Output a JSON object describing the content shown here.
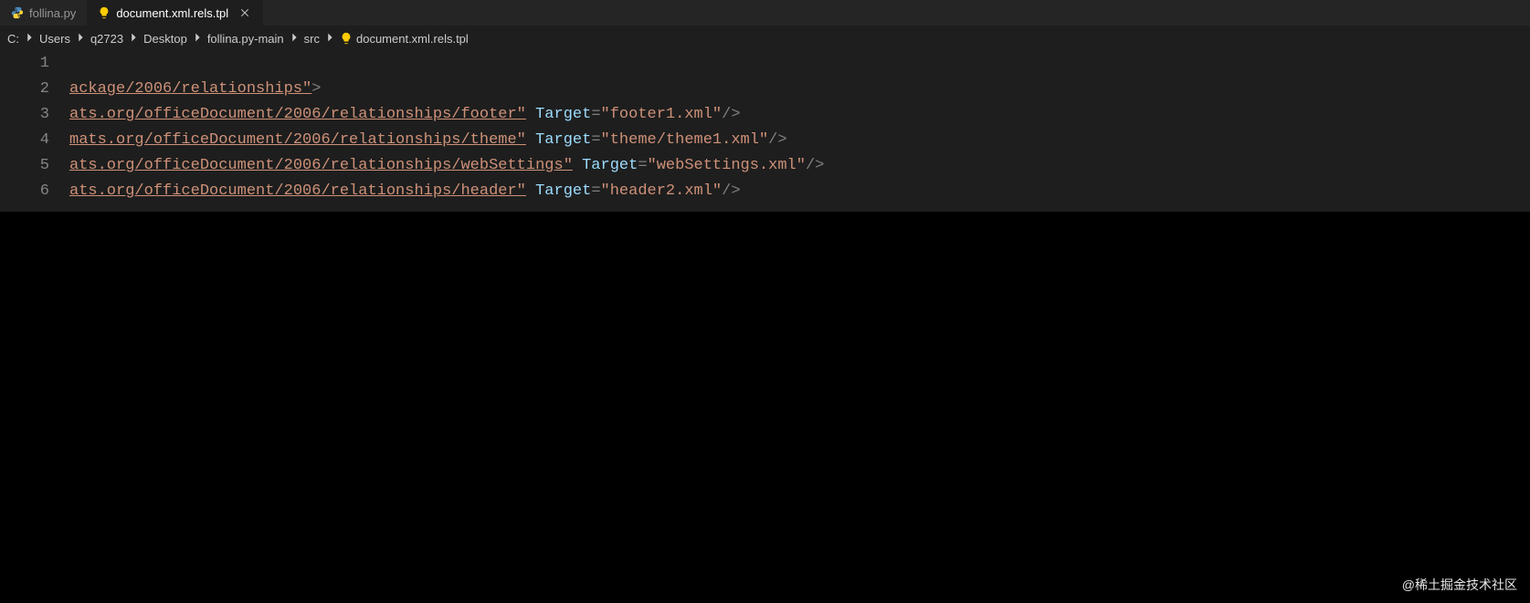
{
  "tabs": [
    {
      "label": "follina.py",
      "icon": "python",
      "active": false,
      "closable": false
    },
    {
      "label": "document.xml.rels.tpl",
      "icon": "bulb",
      "active": true,
      "closable": true
    }
  ],
  "breadcrumbs": {
    "items": [
      "C:",
      "Users",
      "q2723",
      "Desktop",
      "follina.py-main",
      "src"
    ],
    "file": {
      "icon": "bulb",
      "label": "document.xml.rels.tpl"
    }
  },
  "code": {
    "lines": [
      {
        "num": "1",
        "tokens": []
      },
      {
        "num": "2",
        "tokens": [
          {
            "t": "ackage/2006/relationships\"",
            "c": "tk-string-u"
          },
          {
            "t": ">",
            "c": "tk-punct"
          }
        ]
      },
      {
        "num": "3",
        "tokens": [
          {
            "t": "ats.org/officeDocument/2006/relationships/footer\"",
            "c": "tk-string-u"
          },
          {
            "t": " ",
            "c": ""
          },
          {
            "t": "Target",
            "c": "tk-attr"
          },
          {
            "t": "=",
            "c": "tk-punct"
          },
          {
            "t": "\"footer1.xml\"",
            "c": "tk-string"
          },
          {
            "t": "/>",
            "c": "tk-punct"
          }
        ]
      },
      {
        "num": "4",
        "tokens": [
          {
            "t": "mats.org/officeDocument/2006/relationships/theme\"",
            "c": "tk-string-u"
          },
          {
            "t": " ",
            "c": ""
          },
          {
            "t": "Target",
            "c": "tk-attr"
          },
          {
            "t": "=",
            "c": "tk-punct"
          },
          {
            "t": "\"theme/theme1.xml\"",
            "c": "tk-string"
          },
          {
            "t": "/>",
            "c": "tk-punct"
          }
        ]
      },
      {
        "num": "5",
        "tokens": [
          {
            "t": "ats.org/officeDocument/2006/relationships/webSettings\"",
            "c": "tk-string-u"
          },
          {
            "t": " ",
            "c": ""
          },
          {
            "t": "Target",
            "c": "tk-attr"
          },
          {
            "t": "=",
            "c": "tk-punct"
          },
          {
            "t": "\"webSettings.xml\"",
            "c": "tk-string"
          },
          {
            "t": "/>",
            "c": "tk-punct"
          }
        ]
      },
      {
        "num": "6",
        "tokens": [
          {
            "t": "ats.org/officeDocument/2006/relationships/header\"",
            "c": "tk-string-u"
          },
          {
            "t": " ",
            "c": ""
          },
          {
            "t": "Target",
            "c": "tk-attr"
          },
          {
            "t": "=",
            "c": "tk-punct"
          },
          {
            "t": "\"header2.xml\"",
            "c": "tk-string"
          },
          {
            "t": "/>",
            "c": "tk-punct"
          }
        ]
      }
    ]
  },
  "watermark": "@稀土掘金技术社区"
}
